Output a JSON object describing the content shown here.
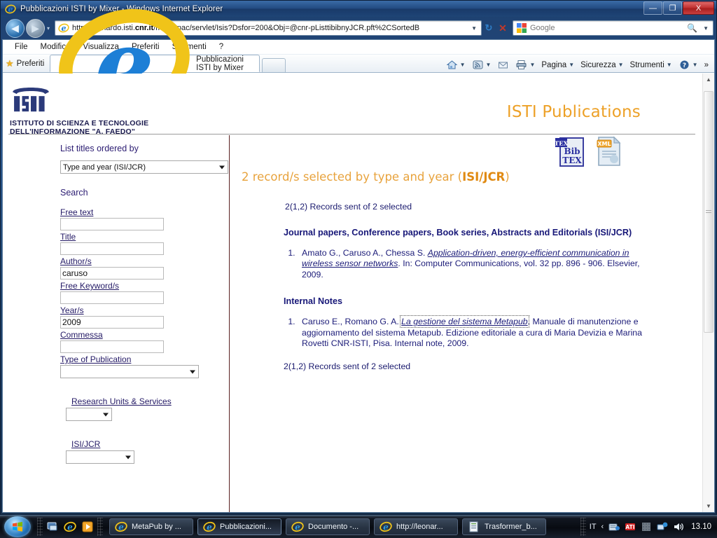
{
  "window": {
    "title": "Pubblicazioni ISTI by Mixer - Windows Internet Explorer",
    "minimize_label": "—",
    "maximize_label": "❐",
    "close_label": "X"
  },
  "nav": {
    "back_label": "◀",
    "forward_label": "▶",
    "url": "http://leonardo.isti.cnr.it/metaopac/servlet/Isis?Dsfor=200&Obj=@cnr-pListtibibnyJCR.pft%2CSortedB",
    "url_domain": "cnr.it",
    "refresh_label": "↻",
    "stop_label": "✕",
    "dropdown_label": "▼",
    "search_placeholder": "Google",
    "search_value": "Google"
  },
  "menu": {
    "items": [
      "File",
      "Modifica",
      "Visualizza",
      "Preferiti",
      "Strumenti",
      "?"
    ]
  },
  "tabs": {
    "favorites_label": "Preferiti",
    "active_tab": "Pubblicazioni ISTI by Mixer",
    "new_tab_label": ""
  },
  "commandbar": {
    "items": [
      {
        "name": "home",
        "label": "",
        "icon": "home-icon",
        "caret": "▼"
      },
      {
        "name": "feeds",
        "label": "",
        "icon": "feed-icon",
        "caret": "▼"
      },
      {
        "name": "mail",
        "label": "",
        "icon": "mail-icon",
        "caret": ""
      },
      {
        "name": "print",
        "label": "",
        "icon": "print-icon",
        "caret": "▼"
      },
      {
        "name": "page",
        "label": "Pagina",
        "icon": "",
        "caret": "▼"
      },
      {
        "name": "safety",
        "label": "Sicurezza",
        "icon": "",
        "caret": "▼"
      },
      {
        "name": "tools",
        "label": "Strumenti",
        "icon": "",
        "caret": "▼"
      },
      {
        "name": "help",
        "label": "",
        "icon": "help-icon",
        "caret": "▼"
      }
    ],
    "overflow_label": "»"
  },
  "page": {
    "institute_line1": "ISTITUTO DI SCIENZA E TECNOLOGIE",
    "institute_line2": "DELL'INFORMAZIONE \"A. FAEDO\"",
    "logo_text": "ISTI",
    "site_title": "ISTI Publications"
  },
  "sidebar": {
    "order_heading": "List titles ordered by",
    "order_value": "Type and year (ISI/JCR)",
    "search_heading": "Search",
    "fields": [
      {
        "label": "Free text",
        "value": "",
        "name": "free-text"
      },
      {
        "label": "Title",
        "value": "",
        "name": "title"
      },
      {
        "label": "Author/s",
        "value": "caruso",
        "name": "authors"
      },
      {
        "label": "Free Keyword/s",
        "value": "",
        "name": "free-keywords"
      },
      {
        "label": "Year/s",
        "value": "2009",
        "name": "years"
      },
      {
        "label": "Commessa",
        "value": "",
        "name": "commessa"
      }
    ],
    "type_label": "Type of Publication",
    "type_value": "",
    "units_label": "Research Units & Services",
    "units_value": "",
    "isijcr_label": "ISI/JCR",
    "isijcr_value": ""
  },
  "main": {
    "result_heading_pre": "2 record/s selected by type and year (",
    "result_heading_bold": "ISI/JCR",
    "result_heading_post": ")",
    "sent_top": "2(1,2) Records sent of 2 selected",
    "sent_bottom": "2(1,2) Records sent of 2 selected",
    "export": [
      {
        "name": "bibtex-export-icon",
        "label": "BibTeX"
      },
      {
        "name": "xml-export-icon",
        "label": "XML"
      }
    ],
    "groups": [
      {
        "heading": "Journal papers, Conference papers, Book series, Abstracts and Editorials (ISI/JCR)",
        "items": [
          {
            "authors": "Amato G., Caruso A., Chessa S. ",
            "title": "Application-driven, energy-efficient communication in wireless sensor networks",
            "rest": ". In: Computer Communications, vol. 32 pp. 896 - 906. Elsevier, 2009.",
            "focused": false
          }
        ]
      },
      {
        "heading": "Internal Notes",
        "items": [
          {
            "authors": "Caruso E., Romano G. A. ",
            "title": "La gestione del sistema Metapub",
            "rest": ". Manuale di manutenzione e aggiornamento del sistema Metapub. Edizione editoriale a cura di Maria Devizia e Marina Rovetti CNR-ISTI, Pisa. Internal note, 2009.",
            "focused": true
          }
        ]
      }
    ]
  },
  "scrollbar": {
    "up_label": "▲",
    "down_label": "▼"
  },
  "taskbar": {
    "start_label": "",
    "quicklaunch": [
      {
        "name": "show-desktop-icon",
        "label": ""
      },
      {
        "name": "internet-explorer-icon",
        "label": ""
      },
      {
        "name": "media-player-icon",
        "label": ""
      }
    ],
    "tasks": [
      {
        "label": "MetaPub by ...",
        "icon": "internet-explorer-icon",
        "active": false
      },
      {
        "label": "Pubblicazioni...",
        "icon": "internet-explorer-icon",
        "active": true
      },
      {
        "label": "Documento -...",
        "icon": "internet-explorer-icon",
        "active": false
      },
      {
        "label": "http://leonar...",
        "icon": "internet-explorer-icon",
        "active": false
      },
      {
        "label": "Trasformer_b...",
        "icon": "document-icon",
        "active": false
      }
    ],
    "tray": {
      "language": "IT",
      "expand_label": "‹",
      "icons": [
        "ati-catalyst-icon",
        "keyboard-icon",
        "network-icon",
        "volume-icon"
      ],
      "clock": "13.10"
    }
  },
  "colors": {
    "accent_orange": "#eda128",
    "link_navy": "#1b1b78",
    "label_purple": "#241a66",
    "isti_blue": "#1a1a4e"
  }
}
